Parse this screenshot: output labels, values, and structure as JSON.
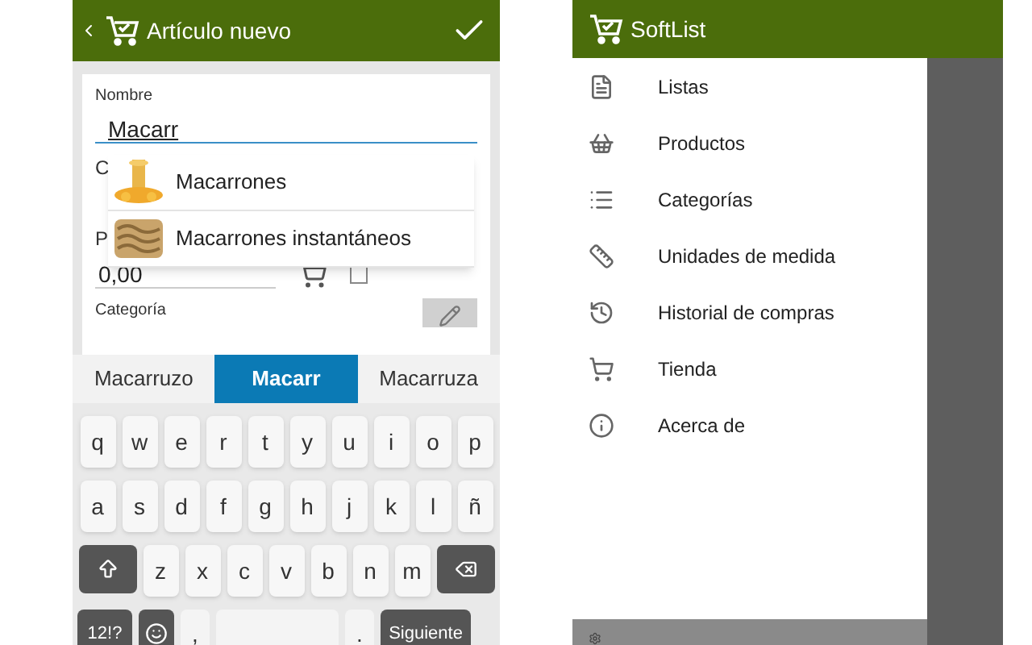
{
  "left_screen": {
    "title": "Artículo nuevo",
    "form": {
      "name_label": "Nombre",
      "name_value": "Macarr",
      "hidden_label_1": "C",
      "hidden_label_2": "P",
      "price_value": "0,00",
      "cart_checked": false,
      "category_label": "Categoría"
    },
    "suggestions_dropdown": [
      {
        "label": "Macarrones",
        "kind": "picture"
      },
      {
        "label": "Macarrones instantáneos",
        "kind": "picture"
      }
    ],
    "keyboard": {
      "suggestions": [
        {
          "label": "Macarruzo",
          "selected": false
        },
        {
          "label": "Macarr",
          "selected": true
        },
        {
          "label": "Macarruza",
          "selected": false
        }
      ],
      "rows": [
        [
          "q",
          "w",
          "e",
          "r",
          "t",
          "y",
          "u",
          "i",
          "o",
          "p"
        ],
        [
          "a",
          "s",
          "d",
          "f",
          "g",
          "h",
          "j",
          "k",
          "l",
          "ñ"
        ],
        [
          "z",
          "x",
          "c",
          "v",
          "b",
          "n",
          "m"
        ]
      ],
      "bottom_keys": [
        {
          "label": "12!?",
          "kind": "dark"
        },
        {
          "kind": "emoji"
        },
        {
          "label": ",",
          "kind": "light"
        },
        {
          "kind": "space"
        },
        {
          "label": ".",
          "kind": "light"
        },
        {
          "label": "Siguiente",
          "kind": "dark"
        }
      ]
    }
  },
  "right_screen": {
    "title": "SoftList",
    "drawer_items": [
      {
        "label": "Listas"
      },
      {
        "label": "Productos"
      },
      {
        "label": "Categorías"
      },
      {
        "label": "Unidades de medida"
      },
      {
        "label": "Historial de compras"
      },
      {
        "label": "Tienda"
      },
      {
        "label": "Acerca de"
      }
    ]
  }
}
